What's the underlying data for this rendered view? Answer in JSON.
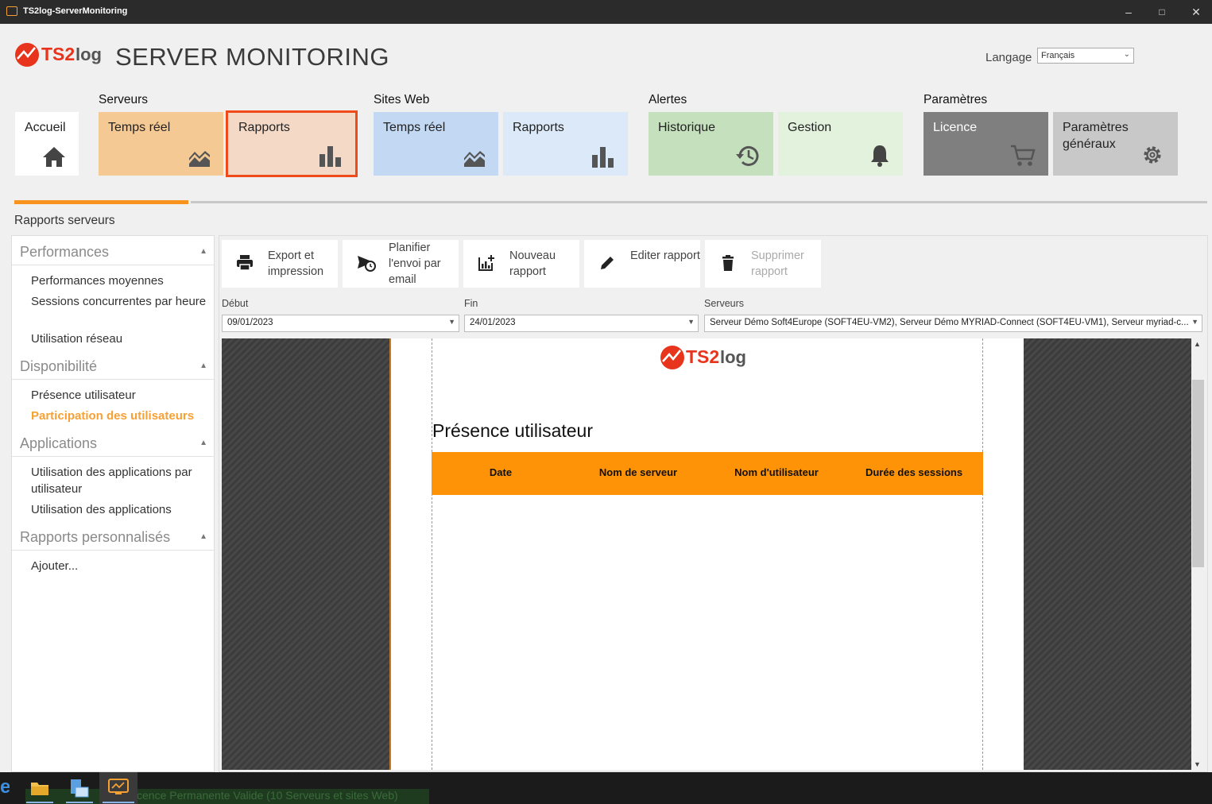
{
  "window": {
    "title": "TS2log-ServerMonitoring"
  },
  "header": {
    "logo_text_ts2": "TS2",
    "logo_text_log": "log",
    "app_title": "SERVER MONITORING",
    "language_label": "Langage",
    "language_value": "Français"
  },
  "nav": {
    "home": {
      "label": "Accueil"
    },
    "groups": [
      {
        "label": "Serveurs",
        "tiles": [
          {
            "label": "Temps réel"
          },
          {
            "label": "Rapports"
          }
        ]
      },
      {
        "label": "Sites Web",
        "tiles": [
          {
            "label": "Temps réel"
          },
          {
            "label": "Rapports"
          }
        ]
      },
      {
        "label": "Alertes",
        "tiles": [
          {
            "label": "Historique"
          },
          {
            "label": "Gestion"
          }
        ]
      },
      {
        "label": "Paramètres",
        "tiles": [
          {
            "label": "Licence"
          },
          {
            "label": "Paramètres généraux"
          }
        ]
      }
    ]
  },
  "section_title": "Rapports serveurs",
  "sidebar": {
    "categories": [
      {
        "label": "Performances",
        "items": [
          "Performances moyennes",
          "Sessions concurrentes par heure",
          "Utilisation réseau"
        ]
      },
      {
        "label": "Disponibilité",
        "items": [
          "Présence utilisateur",
          "Participation des utilisateurs"
        ]
      },
      {
        "label": "Applications",
        "items": [
          "Utilisation des applications par utilisateur",
          "Utilisation des applications"
        ]
      },
      {
        "label": "Rapports personnalisés",
        "items": [
          "Ajouter..."
        ]
      }
    ]
  },
  "toolbar": {
    "export": "Export et impression",
    "schedule": "Planifier l'envoi par email",
    "new_report": "Nouveau rapport",
    "edit_report": "Editer rapport",
    "delete_report": "Supprimer rapport"
  },
  "filters": {
    "start_label": "Début",
    "start_value": "09/01/2023",
    "end_label": "Fin",
    "end_value": "24/01/2023",
    "servers_label": "Serveurs",
    "servers_value": "Serveur Démo Soft4Europe (SOFT4EU-VM2), Serveur Démo MYRIAD-Connect (SOFT4EU-VM1), Serveur myriad-c..."
  },
  "report": {
    "logo_ts2": "TS2",
    "logo_log": "log",
    "title": "Présence utilisateur",
    "columns": [
      "Date",
      "Nom de serveur",
      "Nom d'utilisateur",
      "Durée des sessions"
    ]
  },
  "statusbar": {
    "text": "cence Permanente Valide (10 Serveurs et sites Web)"
  },
  "colors": {
    "accent": "#f7931e",
    "header_orange": "#ff9307",
    "highlight_border": "#f04a1a"
  }
}
